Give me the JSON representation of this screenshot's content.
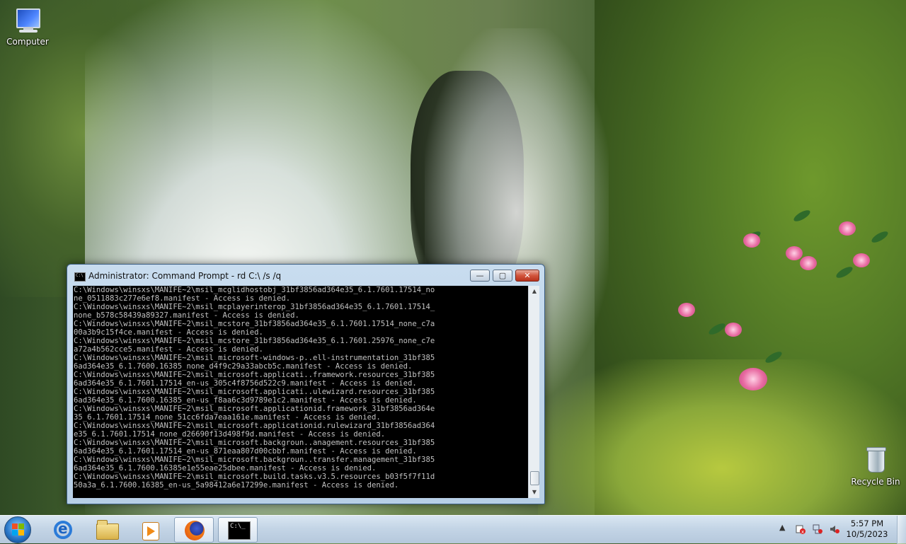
{
  "desktop": {
    "icons": [
      {
        "label": "Computer"
      },
      {
        "label": "Recycle Bin"
      }
    ]
  },
  "cmd_window": {
    "title": "Administrator:  Command Prompt - rd  C:\\ /s /q",
    "buttons": {
      "minimize": "—",
      "maximize": "▢",
      "close": "✕"
    },
    "lines": [
      "C:\\Windows\\winsxs\\MANIFE~2\\msil_mcglidhostobj_31bf3856ad364e35_6.1.7601.17514_no",
      "ne_0511883c277e6ef8.manifest - Access is denied.",
      "C:\\Windows\\winsxs\\MANIFE~2\\msil_mcplayerinterop_31bf3856ad364e35_6.1.7601.17514_",
      "none_b578c58439a89327.manifest - Access is denied.",
      "C:\\Windows\\winsxs\\MANIFE~2\\msil_mcstore_31bf3856ad364e35_6.1.7601.17514_none_c7a",
      "00a3b9c15f4ce.manifest - Access is denied.",
      "C:\\Windows\\winsxs\\MANIFE~2\\msil_mcstore_31bf3856ad364e35_6.1.7601.25976_none_c7e",
      "a72a4b562cce5.manifest - Access is denied.",
      "C:\\Windows\\winsxs\\MANIFE~2\\msil_microsoft-windows-p..ell-instrumentation_31bf385",
      "6ad364e35_6.1.7600.16385_none_d4f9c29a33abcb5c.manifest - Access is denied.",
      "C:\\Windows\\winsxs\\MANIFE~2\\msil_microsoft.applicati..framework.resources_31bf385",
      "6ad364e35_6.1.7601.17514_en-us_305c4f8756d522c9.manifest - Access is denied.",
      "C:\\Windows\\winsxs\\MANIFE~2\\msil_microsoft.applicati..ulewizard.resources_31bf385",
      "6ad364e35_6.1.7600.16385_en-us_f8aa6c3d9789e1c2.manifest - Access is denied.",
      "C:\\Windows\\winsxs\\MANIFE~2\\msil_microsoft.applicationid.framework_31bf3856ad364e",
      "35_6.1.7601.17514_none_51cc6fda7eaa161e.manifest - Access is denied.",
      "C:\\Windows\\winsxs\\MANIFE~2\\msil_microsoft.applicationid.rulewizard_31bf3856ad364",
      "e35_6.1.7601.17514_none_d26690f13d498f9d.manifest - Access is denied.",
      "C:\\Windows\\winsxs\\MANIFE~2\\msil_microsoft.backgroun..anagement.resources_31bf385",
      "6ad364e35_6.1.7601.17514_en-us_871eaa807d00cbbf.manifest - Access is denied.",
      "C:\\Windows\\winsxs\\MANIFE~2\\msil_microsoft.backgroun..transfer.management_31bf385",
      "6ad364e35_6.1.7600.16385e1e55eae25dbee.manifest - Access is denied.",
      "C:\\Windows\\winsxs\\MANIFE~2\\msil_microsoft.build.tasks.v3.5.resources_b03f5f7f11d",
      "50a3a_6.1.7600.16385_en-us_5a98412a6e17299e.manifest - Access is denied."
    ]
  },
  "taskbar": {
    "items": [
      {
        "icon": "start-orb-icon"
      },
      {
        "icon": "internet-explorer-icon"
      },
      {
        "icon": "file-explorer-icon"
      },
      {
        "icon": "media-player-icon"
      },
      {
        "icon": "firefox-icon"
      },
      {
        "icon": "command-prompt-icon",
        "active": true
      }
    ],
    "tray": {
      "show_hidden": "▲",
      "time": "5:57 PM",
      "date": "10/5/2023"
    }
  },
  "colors": {
    "console_bg": "#000000",
    "console_text": "#c0c0c0",
    "close_button": "#c9432a",
    "taskbar": "#c4d5e6"
  }
}
